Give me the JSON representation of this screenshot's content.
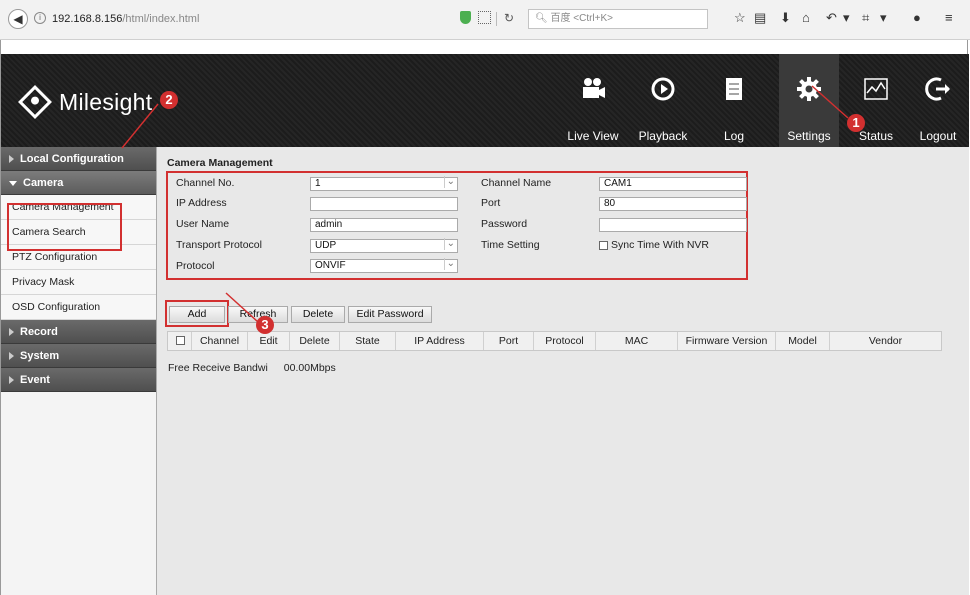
{
  "browser": {
    "url_host": "192.168.8.156",
    "url_path": "/html/index.html",
    "search_placeholder": "百度 <Ctrl+K>"
  },
  "brand": {
    "name": "Milesight"
  },
  "nav": {
    "live_view": "Live View",
    "playback": "Playback",
    "log": "Log",
    "settings": "Settings",
    "status": "Status",
    "logout": "Logout"
  },
  "sidebar": {
    "local_configuration": "Local Configuration",
    "camera": "Camera",
    "camera_items": [
      "Camera Management",
      "Camera Search",
      "PTZ Configuration",
      "Privacy Mask",
      "OSD Configuration"
    ],
    "record": "Record",
    "system": "System",
    "event": "Event"
  },
  "form": {
    "title": "Camera Management",
    "channel_no_label": "Channel No.",
    "channel_no_value": "1",
    "channel_name_label": "Channel Name",
    "channel_name_value": "CAM1",
    "ip_address_label": "IP Address",
    "ip_address_value": "",
    "port_label": "Port",
    "port_value": "80",
    "user_name_label": "User Name",
    "user_name_value": "admin",
    "password_label": "Password",
    "password_value": "",
    "transport_protocol_label": "Transport Protocol",
    "transport_protocol_value": "UDP",
    "time_setting_label": "Time Setting",
    "sync_time_label": "Sync Time With NVR",
    "protocol_label": "Protocol",
    "protocol_value": "ONVIF"
  },
  "buttons": {
    "add": "Add",
    "refresh": "Refresh",
    "delete": "Delete",
    "edit_password": "Edit Password"
  },
  "table": {
    "columns": [
      "Channel",
      "Edit",
      "Delete",
      "State",
      "IP Address",
      "Port",
      "Protocol",
      "MAC",
      "Firmware Version",
      "Model",
      "Vendor"
    ]
  },
  "bandwidth": {
    "label": "Free Receive Bandwi",
    "value": "00.00Mbps"
  },
  "callouts": [
    "1",
    "2",
    "3"
  ],
  "colors": {
    "highlight": "#d23030",
    "header_bg": "#202020"
  }
}
